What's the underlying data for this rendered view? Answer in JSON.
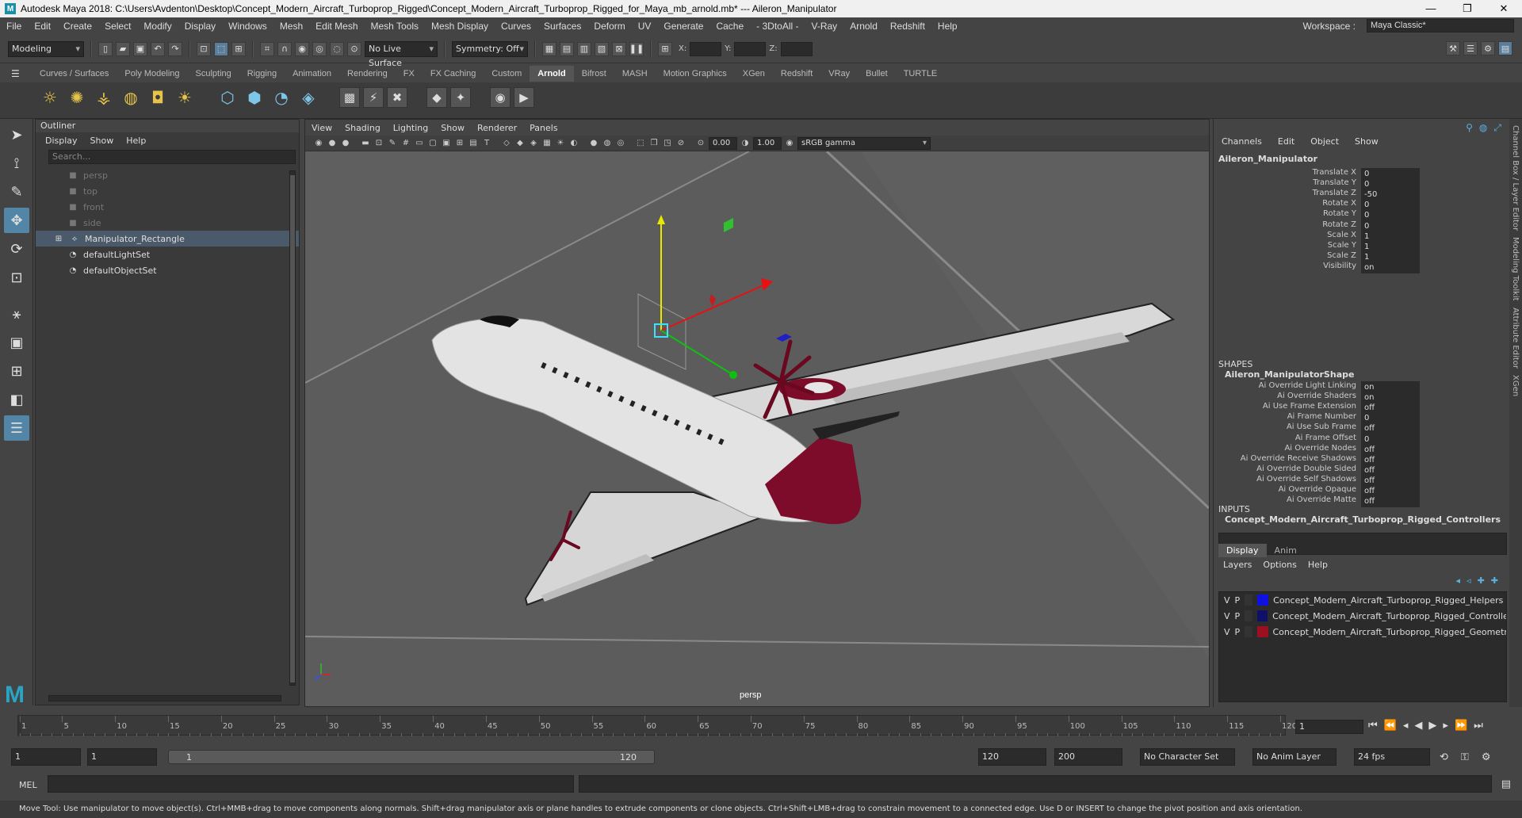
{
  "window": {
    "title": "Autodesk Maya 2018: C:\\Users\\Avdenton\\Desktop\\Concept_Modern_Aircraft_Turboprop_Rigged\\Concept_Modern_Aircraft_Turboprop_Rigged_for_Maya_mb_arnold.mb*   ---   Aileron_Manipulator",
    "controls": [
      "—",
      "❐",
      "✕"
    ]
  },
  "menus": [
    "File",
    "Edit",
    "Create",
    "Select",
    "Modify",
    "Display",
    "Windows",
    "Mesh",
    "Edit Mesh",
    "Mesh Tools",
    "Mesh Display",
    "Curves",
    "Surfaces",
    "Deform",
    "UV",
    "Generate",
    "Cache",
    "- 3DtoAll -",
    "V-Ray",
    "Arnold",
    "Redshift",
    "Help"
  ],
  "workspace": {
    "label": "Workspace :",
    "value": "Maya Classic*"
  },
  "statusline": {
    "mode": "Modeling",
    "live_surface": "No Live Surface",
    "symmetry": "Symmetry: Off",
    "x_label": "X:",
    "y_label": "Y:",
    "z_label": "Z:"
  },
  "shelf_tabs": [
    "Curves / Surfaces",
    "Poly Modeling",
    "Sculpting",
    "Rigging",
    "Animation",
    "Rendering",
    "FX",
    "FX Caching",
    "Custom",
    "Arnold",
    "Bifrost",
    "MASH",
    "Motion Graphics",
    "XGen",
    "Redshift",
    "VRay",
    "Bullet",
    "TURTLE"
  ],
  "shelf_active": "Arnold",
  "outliner": {
    "title": "Outliner",
    "menu": [
      "Display",
      "Show",
      "Help"
    ],
    "search_placeholder": "Search...",
    "items": [
      {
        "label": "persp",
        "dim": true,
        "icon": "camera-icon"
      },
      {
        "label": "top",
        "dim": true,
        "icon": "camera-icon"
      },
      {
        "label": "front",
        "dim": true,
        "icon": "camera-icon"
      },
      {
        "label": "side",
        "dim": true,
        "icon": "camera-icon"
      },
      {
        "label": "Manipulator_Rectangle",
        "dim": false,
        "icon": "transform-icon",
        "selected": true,
        "expand": "⊞"
      },
      {
        "label": "defaultLightSet",
        "dim": false,
        "icon": "set-icon"
      },
      {
        "label": "defaultObjectSet",
        "dim": false,
        "icon": "set-icon"
      }
    ]
  },
  "viewport": {
    "menu": [
      "View",
      "Shading",
      "Lighting",
      "Show",
      "Renderer",
      "Panels"
    ],
    "exposure": "0.00",
    "gamma": "1.00",
    "color_space": "sRGB gamma",
    "camera": "persp"
  },
  "channelbox": {
    "menu": [
      "Channels",
      "Edit",
      "Object",
      "Show"
    ],
    "node": "Aileron_Manipulator",
    "channels": [
      {
        "label": "Translate X",
        "value": "0"
      },
      {
        "label": "Translate Y",
        "value": "0"
      },
      {
        "label": "Translate Z",
        "value": "-50"
      },
      {
        "label": "Rotate X",
        "value": "0"
      },
      {
        "label": "Rotate Y",
        "value": "0"
      },
      {
        "label": "Rotate Z",
        "value": "0"
      },
      {
        "label": "Scale X",
        "value": "1"
      },
      {
        "label": "Scale Y",
        "value": "1"
      },
      {
        "label": "Scale Z",
        "value": "1"
      },
      {
        "label": "Visibility",
        "value": "on"
      }
    ],
    "shapes_header": "SHAPES",
    "shape_node": "Aileron_ManipulatorShape",
    "shape_attrs": [
      {
        "label": "Ai Override Light Linking",
        "value": "on"
      },
      {
        "label": "Ai Override Shaders",
        "value": "on"
      },
      {
        "label": "Ai Use Frame Extension",
        "value": "off"
      },
      {
        "label": "Ai Frame Number",
        "value": "0"
      },
      {
        "label": "Ai Use Sub Frame",
        "value": "off"
      },
      {
        "label": "Ai Frame Offset",
        "value": "0"
      },
      {
        "label": "Ai Override Nodes",
        "value": "off"
      },
      {
        "label": "Ai Override Receive Shadows",
        "value": "off"
      },
      {
        "label": "Ai Override Double Sided",
        "value": "off"
      },
      {
        "label": "Ai Override Self Shadows",
        "value": "off"
      },
      {
        "label": "Ai Override Opaque",
        "value": "off"
      },
      {
        "label": "Ai Override Matte",
        "value": "off"
      }
    ],
    "inputs_header": "INPUTS",
    "input_node": "Concept_Modern_Aircraft_Turboprop_Rigged_Controllers"
  },
  "side_tabs": [
    "Channel Box / Layer Editor",
    "Modeling Toolkit",
    "Attribute Editor",
    "XGen"
  ],
  "layers": {
    "tabs": [
      "Display",
      "Anim"
    ],
    "menu": [
      "Layers",
      "Options",
      "Help"
    ],
    "items": [
      {
        "v": "V",
        "p": "P",
        "color": "#1010e0",
        "name": "Concept_Modern_Aircraft_Turboprop_Rigged_Helpers"
      },
      {
        "v": "V",
        "p": "P",
        "color": "#101068",
        "name": "Concept_Modern_Aircraft_Turboprop_Rigged_Controllers"
      },
      {
        "v": "V",
        "p": "P",
        "color": "#9a1020",
        "name": "Concept_Modern_Aircraft_Turboprop_Rigged_Geometry"
      }
    ]
  },
  "timeline": {
    "labels": [
      "1",
      "5",
      "10",
      "15",
      "20",
      "25",
      "30",
      "35",
      "40",
      "45",
      "50",
      "55",
      "60",
      "65",
      "70",
      "75",
      "80",
      "85",
      "90",
      "95",
      "100",
      "105",
      "110",
      "115",
      "120"
    ],
    "current_frame": "1"
  },
  "range": {
    "start": "1",
    "start2": "1",
    "range_start": "1",
    "range_end": "120",
    "end": "120",
    "end2": "200",
    "character_set": "No Character Set",
    "anim_layer": "No Anim Layer",
    "fps": "24 fps"
  },
  "cmdline": {
    "label": "MEL"
  },
  "help_text": "Move Tool: Use manipulator to move object(s). Ctrl+MMB+drag to move components along normals. Shift+drag manipulator axis or plane handles to extrude components or clone objects. Ctrl+Shift+LMB+drag to constrain movement to a connected edge. Use D or INSERT to change the pivot position and axis orientation."
}
